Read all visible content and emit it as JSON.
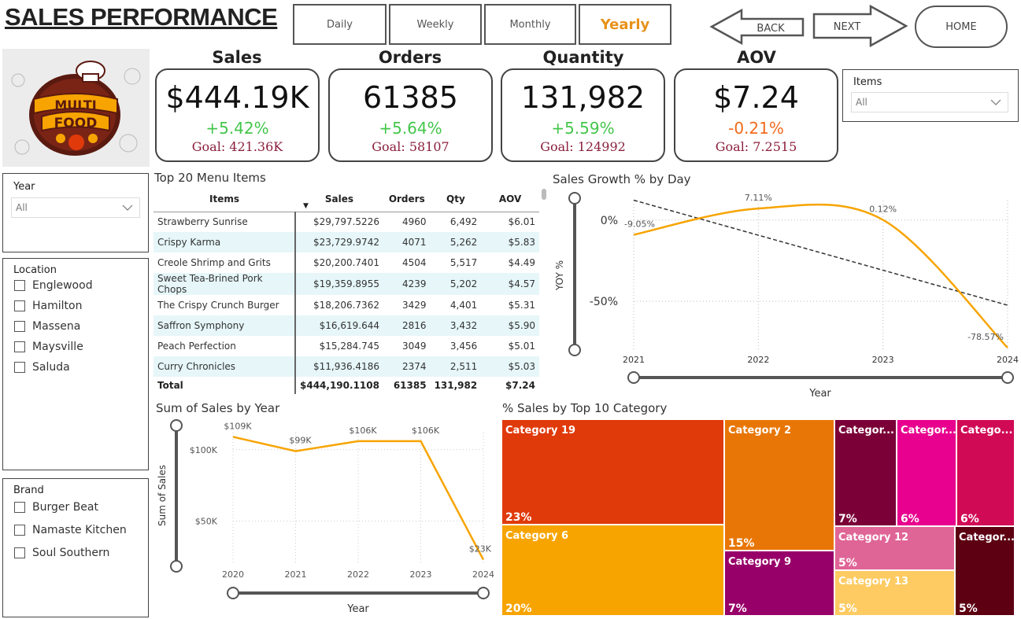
{
  "title": "SALES PERFORMANCE",
  "period_buttons": [
    {
      "label": "Daily",
      "active": false
    },
    {
      "label": "Weekly",
      "active": false
    },
    {
      "label": "Monthly",
      "active": false
    },
    {
      "label": "Yearly",
      "active": true
    }
  ],
  "nav": {
    "back": "BACK",
    "next": "NEXT",
    "home": "HOME"
  },
  "logo": {
    "line1": "MULTI",
    "line2": "FOOD"
  },
  "kpis": [
    {
      "title": "Sales",
      "value": "$444.19K",
      "delta": "+5.42%",
      "delta_color": "#43c64b",
      "goal": "Goal: 421.36K"
    },
    {
      "title": "Orders",
      "value": "61385",
      "delta": "+5.64%",
      "delta_color": "#43c64b",
      "goal": "Goal: 58107"
    },
    {
      "title": "Quantity",
      "value": "131,982",
      "delta": "+5.59%",
      "delta_color": "#43c64b",
      "goal": "Goal: 124992"
    },
    {
      "title": "AOV",
      "value": "$7.24",
      "delta": "-0.21%",
      "delta_color": "#f06a1c",
      "goal": "Goal: 7.2515"
    }
  ],
  "items_slicer": {
    "label": "Items",
    "value": "All"
  },
  "year_slicer": {
    "label": "Year",
    "value": "All"
  },
  "location_slicer": {
    "label": "Location",
    "options": [
      "Englewood",
      "Hamilton",
      "Massena",
      "Maysville",
      "Saluda"
    ]
  },
  "brand_slicer": {
    "label": "Brand",
    "options": [
      "Burger Beat",
      "Namaste Kitchen",
      "Soul Southern"
    ]
  },
  "menu_table": {
    "title": "Top 20 Menu Items",
    "headers": [
      "Items",
      "Sales",
      "Orders",
      "Qty",
      "AOV"
    ],
    "rows": [
      [
        "Strawberry Sunrise",
        "$29,797.5226",
        "4960",
        "6,492",
        "$6.01"
      ],
      [
        "Crispy Karma",
        "$23,729.9742",
        "4071",
        "5,262",
        "$5.83"
      ],
      [
        "Creole Shrimp and Grits",
        "$20,200.7401",
        "4504",
        "5,517",
        "$4.49"
      ],
      [
        "Sweet Tea-Brined Pork Chops",
        "$19,359.8955",
        "4239",
        "5,202",
        "$4.57"
      ],
      [
        "The Crispy Crunch Burger",
        "$18,206.7362",
        "3429",
        "4,401",
        "$5.31"
      ],
      [
        "Saffron Symphony",
        "$16,619.644",
        "2816",
        "3,432",
        "$5.90"
      ],
      [
        "Peach Perfection",
        "$15,284.745",
        "3049",
        "3,456",
        "$5.01"
      ],
      [
        "Curry Chronicles",
        "$11,936.4186",
        "2374",
        "2,511",
        "$5.03"
      ]
    ],
    "total": [
      "Total",
      "$444,190.1108",
      "61385",
      "131,982",
      "$7.24"
    ]
  },
  "chart_data": [
    {
      "type": "line",
      "title": "Sales Growth % by Day",
      "xlabel": "Year",
      "ylabel": "YOY %",
      "x": [
        2021,
        2022,
        2023,
        2024
      ],
      "series": [
        {
          "values": [
            -9.05,
            7.11,
            0.12,
            -78.57
          ]
        }
      ],
      "data_labels": [
        "-9.05%",
        "7.11%",
        "0.12%",
        "-78.57%"
      ],
      "trendline": true,
      "ylim": [
        -80,
        12
      ],
      "yticks": [
        "0%",
        "-50%"
      ],
      "xticks": [
        "2021",
        "2022",
        "2023",
        "2024"
      ],
      "grid": true
    },
    {
      "type": "line",
      "title": "Sum of Sales by Year",
      "xlabel": "Year",
      "ylabel": "Sum of Sales",
      "x": [
        2020,
        2021,
        2022,
        2023,
        2024
      ],
      "series": [
        {
          "values": [
            109000,
            99000,
            106000,
            106000,
            23000
          ]
        }
      ],
      "data_labels": [
        "$109K",
        "$99K",
        "$106K",
        "$106K",
        "$23K"
      ],
      "ylim": [
        20000,
        112000
      ],
      "yticks": [
        "$100K",
        "$50K"
      ],
      "xticks": [
        "2020",
        "2021",
        "2022",
        "2023",
        "2024"
      ]
    },
    {
      "type": "treemap",
      "title": "% Sales by Top 10 Category",
      "items": [
        {
          "label": "Category 19",
          "pct": "23%",
          "color": "#e03a0a"
        },
        {
          "label": "Category 6",
          "pct": "20%",
          "color": "#f7a400"
        },
        {
          "label": "Category 2",
          "pct": "15%",
          "color": "#e87606"
        },
        {
          "label": "Category 9",
          "pct": "7%",
          "color": "#980069"
        },
        {
          "label": "Categor...",
          "pct": "7%",
          "color": "#7a0037"
        },
        {
          "label": "Categor...",
          "pct": "6%",
          "color": "#e8008e"
        },
        {
          "label": "Catego...",
          "pct": "6%",
          "color": "#d10a55"
        },
        {
          "label": "Category 12",
          "pct": "5%",
          "color": "#e06597"
        },
        {
          "label": "Category 13",
          "pct": "5%",
          "color": "#fdcb62"
        },
        {
          "label": "Categor...",
          "pct": "5%",
          "color": "#5c0012"
        }
      ]
    }
  ]
}
